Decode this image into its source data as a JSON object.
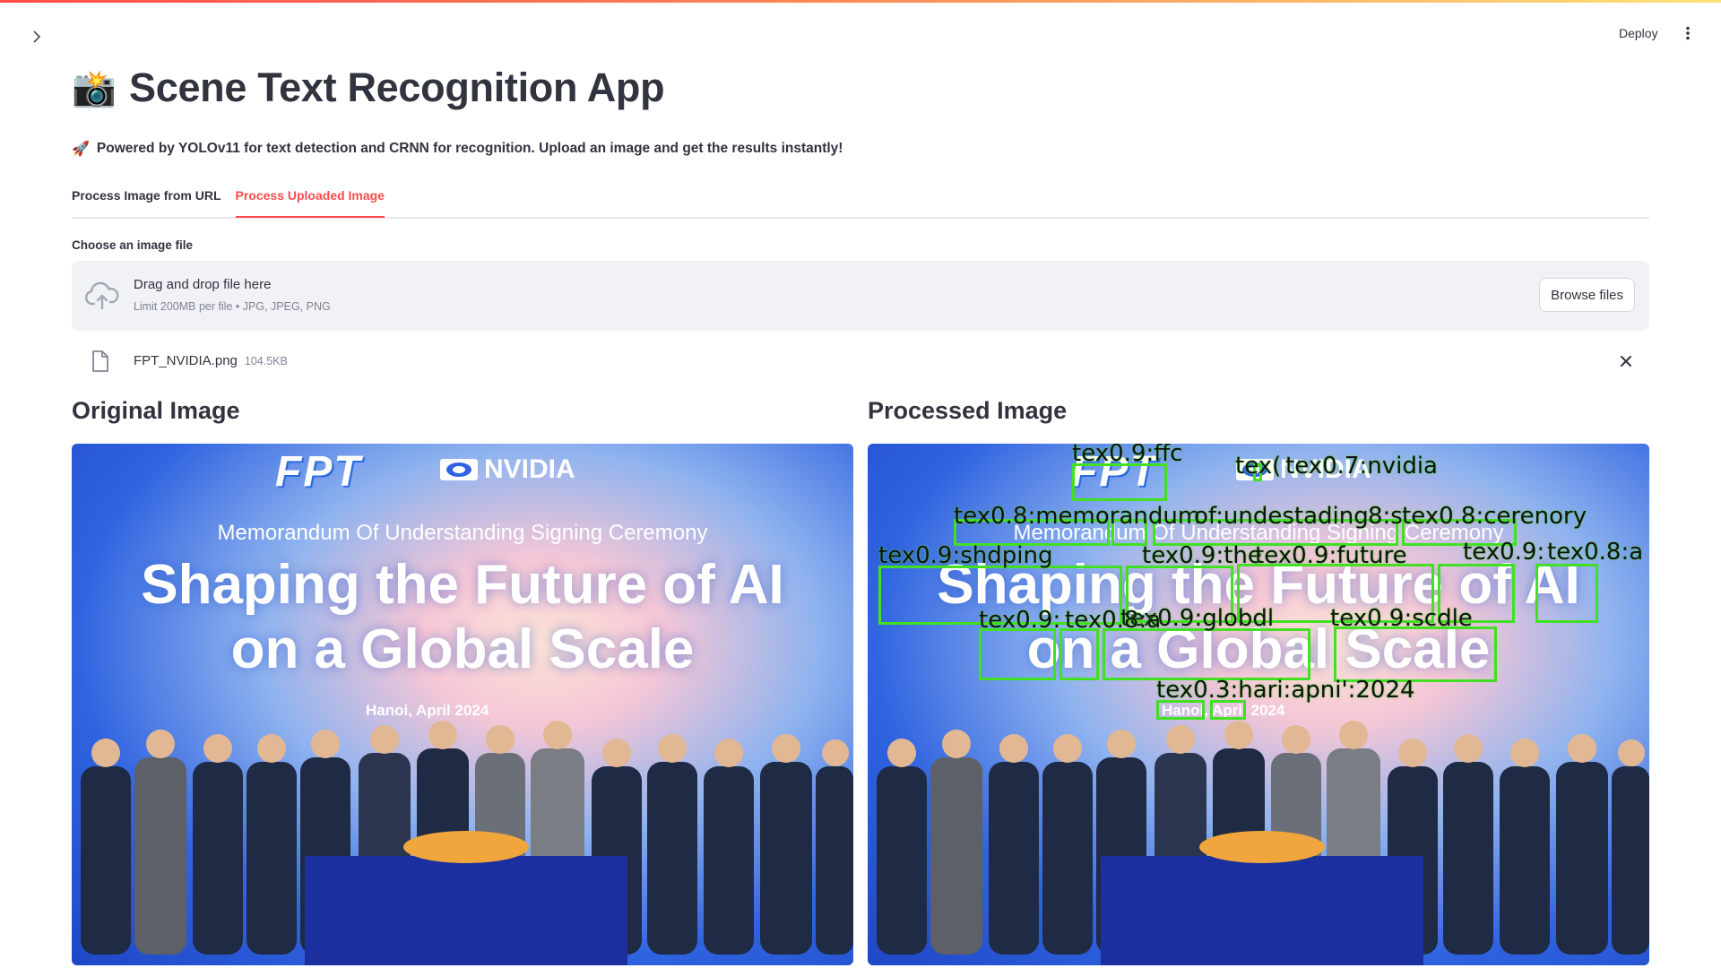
{
  "header": {
    "deploy_label": "Deploy",
    "sidebar_toggle_icon": "chevron-right-icon",
    "menu_icon": "kebab-menu-icon"
  },
  "app": {
    "title_emoji": "📸",
    "title": "Scene Text Recognition App",
    "subtitle_emoji": "🚀",
    "subtitle": "Powered by YOLOv11 for text detection and CRNN for recognition. Upload an image and get the results instantly!"
  },
  "tabs": [
    {
      "label": "Process Image from URL",
      "active": false
    },
    {
      "label": "Process Uploaded Image",
      "active": true
    }
  ],
  "uploader": {
    "label": "Choose an image file",
    "drop_text": "Drag and drop file here",
    "limit_text": "Limit 200MB per file • JPG, JPEG, PNG",
    "browse_label": "Browse files",
    "icon": "cloud-upload-icon"
  },
  "file": {
    "name": "FPT_NVIDIA.png",
    "size": "104.5KB",
    "icon": "file-icon",
    "remove_icon": "close-icon"
  },
  "original": {
    "heading": "Original Image",
    "image": {
      "logo_fpt": "FPT",
      "logo_nvidia": "NVIDIA",
      "mou": "Memorandum Of Understanding Signing Ceremony",
      "line1": "Shaping the Future of AI",
      "line2": "on a Global Scale",
      "place": "Hanoi, April  2024"
    }
  },
  "processed": {
    "heading": "Processed Image",
    "detections": [
      "tex0.9:ffc",
      "tex(",
      "tex0.7:nvidia",
      "tex0.8:memorandum",
      "of:undestading",
      "8:s",
      "tex0.8:cerenory",
      "tex0.9:shdping",
      "tex0.9:the",
      "tex0.9:future",
      "tex0.9:",
      "tex0.8:a",
      "tex0.9:globdl",
      "tex0.9:scdle",
      "tex0.9:",
      "tex0.8:a",
      "tex0.3:hari:apni':2024"
    ]
  },
  "colors": {
    "accent": "#ff4b4b",
    "detection_box": "#41e022",
    "dropzone_bg": "#f0f2f6",
    "text": "#31333f",
    "muted": "#808495"
  }
}
